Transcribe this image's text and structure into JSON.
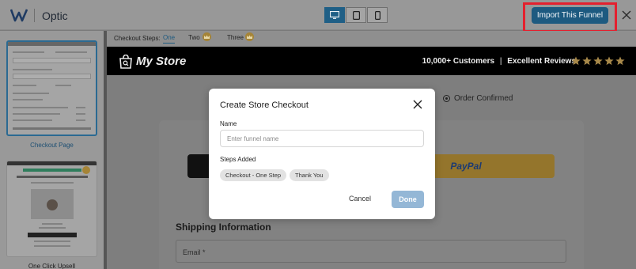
{
  "app": {
    "name": "Optic"
  },
  "toolbar": {
    "devices": [
      {
        "icon": "desktop-icon",
        "active": true
      },
      {
        "icon": "tablet-icon",
        "active": false
      },
      {
        "icon": "mobile-icon",
        "active": false
      }
    ],
    "import_label": "Import This Funnel",
    "close_icon": "close-icon"
  },
  "sidebar": {
    "thumbnails": [
      {
        "label": "Checkout Page",
        "active": true
      },
      {
        "label": "One Click Upsell",
        "active": false
      }
    ]
  },
  "steps": {
    "label": "Checkout Steps:",
    "items": [
      {
        "label": "One",
        "active": true,
        "premium": false
      },
      {
        "label": "Two",
        "active": false,
        "premium": true
      },
      {
        "label": "Three",
        "active": false,
        "premium": true
      }
    ]
  },
  "store": {
    "name": "My Store",
    "customers": "10,000+ Customers",
    "separator": "|",
    "reviews": "Excellent Reviews",
    "stars": 5,
    "order_confirmed": "Order Confirmed",
    "paypal": "PayPal",
    "shipping_title": "Shipping Information",
    "email_placeholder": "Email *"
  },
  "modal": {
    "title": "Create Store Checkout",
    "name_label": "Name",
    "name_placeholder": "Enter funnel name",
    "steps_label": "Steps Added",
    "steps": [
      "Checkout - One Step",
      "Thank You"
    ],
    "cancel": "Cancel",
    "done": "Done"
  },
  "colors": {
    "accent": "#1d5a80",
    "highlight": "#e4202e",
    "done_disabled": "#94b7d6",
    "crown": "#a58437"
  }
}
